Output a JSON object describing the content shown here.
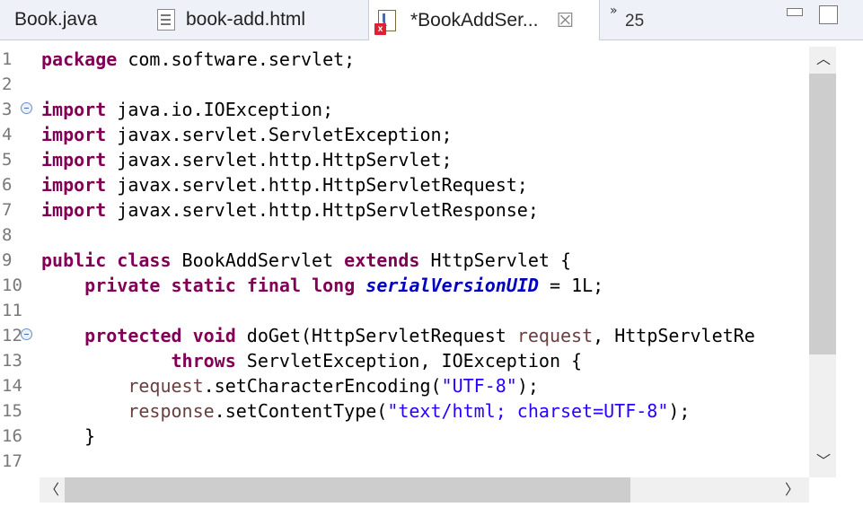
{
  "tabs": [
    {
      "label": "Book.java",
      "icon": "java-file-icon"
    },
    {
      "label": "book-add.html",
      "icon": "html-file-icon"
    },
    {
      "label": "*BookAddSer...",
      "icon": "java-file-error-icon",
      "close": "☒"
    }
  ],
  "overflow": {
    "glyph": "»",
    "count": "25"
  },
  "code_lines": [
    {
      "n": "1",
      "fold": false,
      "parts": [
        [
          "kw",
          "package"
        ],
        [
          "t",
          " com.software.servlet;"
        ]
      ]
    },
    {
      "n": "2",
      "fold": false,
      "parts": []
    },
    {
      "n": "3",
      "fold": true,
      "parts": [
        [
          "kw",
          "import"
        ],
        [
          "t",
          " java.io.IOException;"
        ]
      ]
    },
    {
      "n": "4",
      "fold": false,
      "parts": [
        [
          "kw",
          "import"
        ],
        [
          "t",
          " javax.servlet.ServletException;"
        ]
      ]
    },
    {
      "n": "5",
      "fold": false,
      "parts": [
        [
          "kw",
          "import"
        ],
        [
          "t",
          " javax.servlet.http.HttpServlet;"
        ]
      ]
    },
    {
      "n": "6",
      "fold": false,
      "parts": [
        [
          "kw",
          "import"
        ],
        [
          "t",
          " javax.servlet.http.HttpServletRequest;"
        ]
      ]
    },
    {
      "n": "7",
      "fold": false,
      "parts": [
        [
          "kw",
          "import"
        ],
        [
          "t",
          " javax.servlet.http.HttpServletResponse;"
        ]
      ]
    },
    {
      "n": "8",
      "fold": false,
      "parts": []
    },
    {
      "n": "9",
      "fold": false,
      "parts": [
        [
          "kw",
          "public"
        ],
        [
          "t",
          " "
        ],
        [
          "kw",
          "class"
        ],
        [
          "t",
          " BookAddServlet "
        ],
        [
          "kw",
          "extends"
        ],
        [
          "t",
          " HttpServlet {"
        ]
      ]
    },
    {
      "n": "10",
      "fold": false,
      "parts": [
        [
          "t",
          "    "
        ],
        [
          "kw",
          "private"
        ],
        [
          "t",
          " "
        ],
        [
          "kw",
          "static"
        ],
        [
          "t",
          " "
        ],
        [
          "kw",
          "final"
        ],
        [
          "t",
          " "
        ],
        [
          "kw",
          "long"
        ],
        [
          "t",
          " "
        ],
        [
          "fld",
          "serialVersionUID"
        ],
        [
          "t",
          " = 1L;"
        ]
      ]
    },
    {
      "n": "11",
      "fold": false,
      "parts": []
    },
    {
      "n": "12",
      "fold": true,
      "parts": [
        [
          "t",
          "    "
        ],
        [
          "kw",
          "protected"
        ],
        [
          "t",
          " "
        ],
        [
          "kw",
          "void"
        ],
        [
          "t",
          " doGet(HttpServletRequest "
        ],
        [
          "par",
          "request"
        ],
        [
          "t",
          ", HttpServletRe"
        ]
      ]
    },
    {
      "n": "13",
      "fold": false,
      "parts": [
        [
          "t",
          "            "
        ],
        [
          "kw",
          "throws"
        ],
        [
          "t",
          " ServletException, IOException {"
        ]
      ]
    },
    {
      "n": "14",
      "fold": false,
      "parts": [
        [
          "t",
          "        "
        ],
        [
          "par",
          "request"
        ],
        [
          "t",
          ".setCharacterEncoding("
        ],
        [
          "str",
          "\"UTF-8\""
        ],
        [
          "t",
          ");"
        ]
      ]
    },
    {
      "n": "15",
      "fold": false,
      "parts": [
        [
          "t",
          "        "
        ],
        [
          "par",
          "response"
        ],
        [
          "t",
          ".setContentType("
        ],
        [
          "str",
          "\"text/html; charset=UTF-8\""
        ],
        [
          "t",
          ");"
        ]
      ]
    },
    {
      "n": "16",
      "fold": false,
      "parts": [
        [
          "t",
          "    }"
        ]
      ]
    },
    {
      "n": "17",
      "fold": false,
      "parts": []
    }
  ],
  "colors": {
    "keyword": "#7f0055",
    "string": "#2a00ff",
    "field": "#0000c0",
    "param": "#6a3e3e"
  }
}
